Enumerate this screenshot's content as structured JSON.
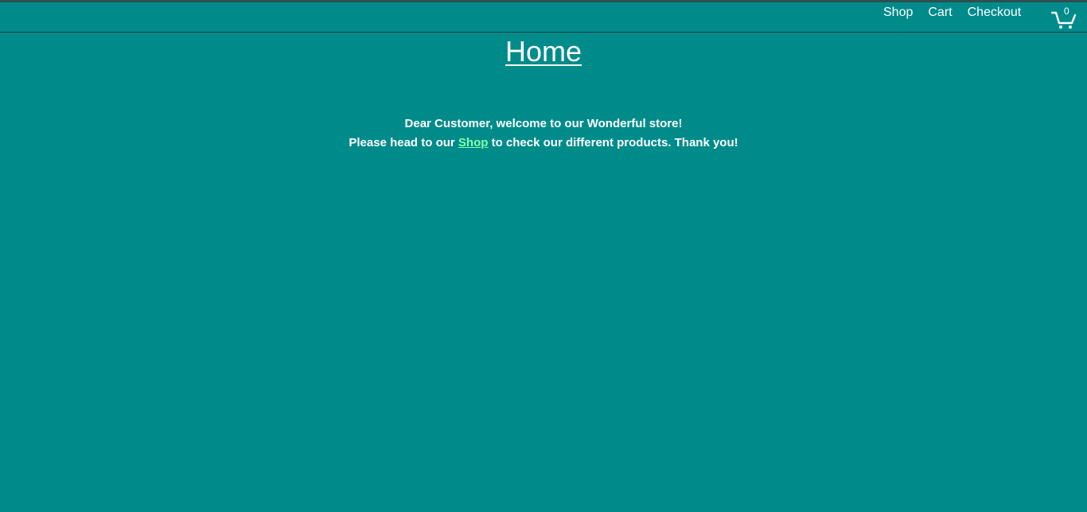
{
  "nav": {
    "links": [
      "Shop",
      "Cart",
      "Checkout"
    ],
    "cart_count": "0",
    "cart_icon": "shopping-cart-icon"
  },
  "main": {
    "title": "Home",
    "line1": "Dear Customer, welcome to our Wonderful store!",
    "line2_before": "Please head to our",
    "line2_link": "Shop",
    "line2_after": "to check our different products. Thank you!"
  },
  "colors": {
    "background": "#008b8b",
    "text": "#ffffff",
    "link_accent": "#7fffa8",
    "top_strip": "#2f4f4f"
  }
}
